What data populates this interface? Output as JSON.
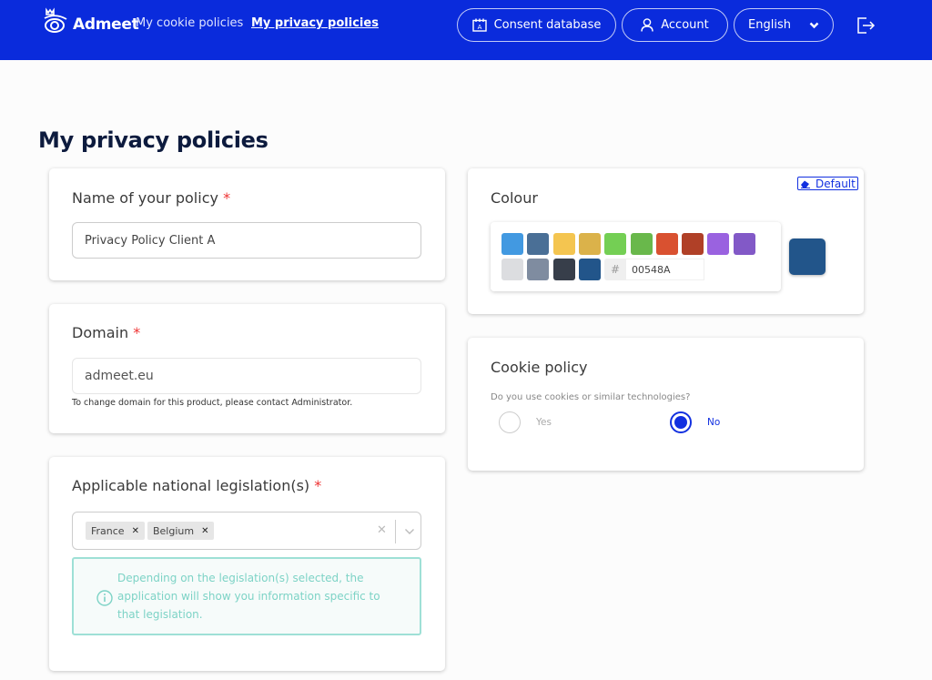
{
  "header": {
    "brand": "Admeet",
    "nav": [
      {
        "label": "My cookie policies",
        "active": false
      },
      {
        "label": "My privacy policies",
        "active": true
      }
    ],
    "consent_database_label": "Consent database",
    "account_label": "Account",
    "language_selected": "English",
    "brand_color": "#0a2bdc"
  },
  "page": {
    "title": "My privacy policies"
  },
  "policy_name": {
    "label": "Name of your policy",
    "required_mark": "*",
    "value": "Privacy Policy Client A"
  },
  "domain": {
    "label": "Domain",
    "required_mark": "*",
    "value": "admeet.eu",
    "help": "To change domain for this product, please contact Administrator."
  },
  "legislation": {
    "label": "Applicable national legislation(s)",
    "required_mark": "*",
    "selected": [
      "France",
      "Belgium"
    ],
    "info": "Depending on the legislation(s) selected, the application will show you information specific to that legislation."
  },
  "colour": {
    "label": "Colour",
    "default_label": "Default",
    "hash_symbol": "#",
    "hex_value": "00548A",
    "selected_color": "#22558a",
    "swatches_row1": [
      "#4299e1",
      "#4a6f96",
      "#f4c550",
      "#dbb24a",
      "#74cf54",
      "#69b84b",
      "#d95130",
      "#b04027",
      "#9a62e0",
      "#8259c7"
    ],
    "swatches_row2": [
      "#dcdde0",
      "#7f8ca0",
      "#373e4a",
      "#22558a"
    ]
  },
  "cookie_policy": {
    "label": "Cookie policy",
    "question": "Do you use cookies or similar technologies?",
    "options": [
      {
        "label": "Yes",
        "selected": false
      },
      {
        "label": "No",
        "selected": true
      }
    ]
  }
}
